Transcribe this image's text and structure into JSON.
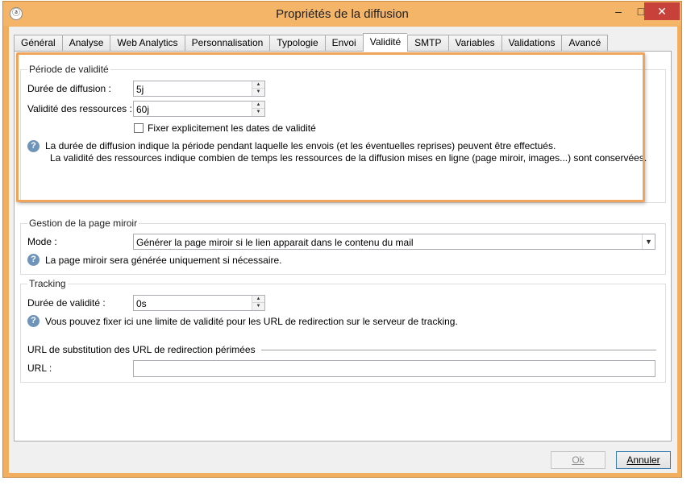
{
  "window": {
    "title": "Propriétés de la diffusion",
    "minimize": "–",
    "maximize": "□",
    "close": "✕"
  },
  "tabs": [
    {
      "label": "Général"
    },
    {
      "label": "Analyse"
    },
    {
      "label": "Web Analytics"
    },
    {
      "label": "Personnalisation"
    },
    {
      "label": "Typologie"
    },
    {
      "label": "Envoi"
    },
    {
      "label": "Validité",
      "active": true
    },
    {
      "label": "SMTP"
    },
    {
      "label": "Variables"
    },
    {
      "label": "Validations"
    },
    {
      "label": "Avancé"
    }
  ],
  "validity": {
    "group_title": "Période de validité",
    "duration_label": "Durée de diffusion :",
    "duration_value": "5j",
    "resources_label": "Validité des ressources :",
    "resources_value": "60j",
    "fix_dates_label": "Fixer explicitement les dates de validité",
    "fix_dates_checked": false,
    "help_line1": "La durée de diffusion indique la période pendant laquelle les envois (et les éventuelles reprises) peuvent être effectués.",
    "help_line2": "La validité des ressources indique combien de temps les ressources de la diffusion mises en ligne (page miroir, images...) sont conservées."
  },
  "mirror": {
    "group_title": "Gestion de la page miroir",
    "mode_label": "Mode :",
    "mode_value": "Générer la page miroir si le lien apparait dans le contenu du mail",
    "help": "La page miroir sera générée uniquement si nécessaire."
  },
  "tracking": {
    "group_title": "Tracking",
    "duration_label": "Durée de validité :",
    "duration_value": "0s",
    "help": "Vous pouvez fixer ici une limite de validité pour les URL de redirection sur le serveur de tracking.",
    "url_section_title": "URL de substitution des URL de redirection périmées",
    "url_label": "URL :",
    "url_value": ""
  },
  "footer": {
    "ok_label": "Ok",
    "cancel_label": "Annuler"
  },
  "icons": {
    "help": "help-icon",
    "spin": "spin-arrows-icon",
    "dropdown": "chevron-down-icon"
  },
  "colors": {
    "window_frame": "#f0ae5e",
    "highlight": "#f0a35a",
    "help_icon": "#6f94b9"
  }
}
